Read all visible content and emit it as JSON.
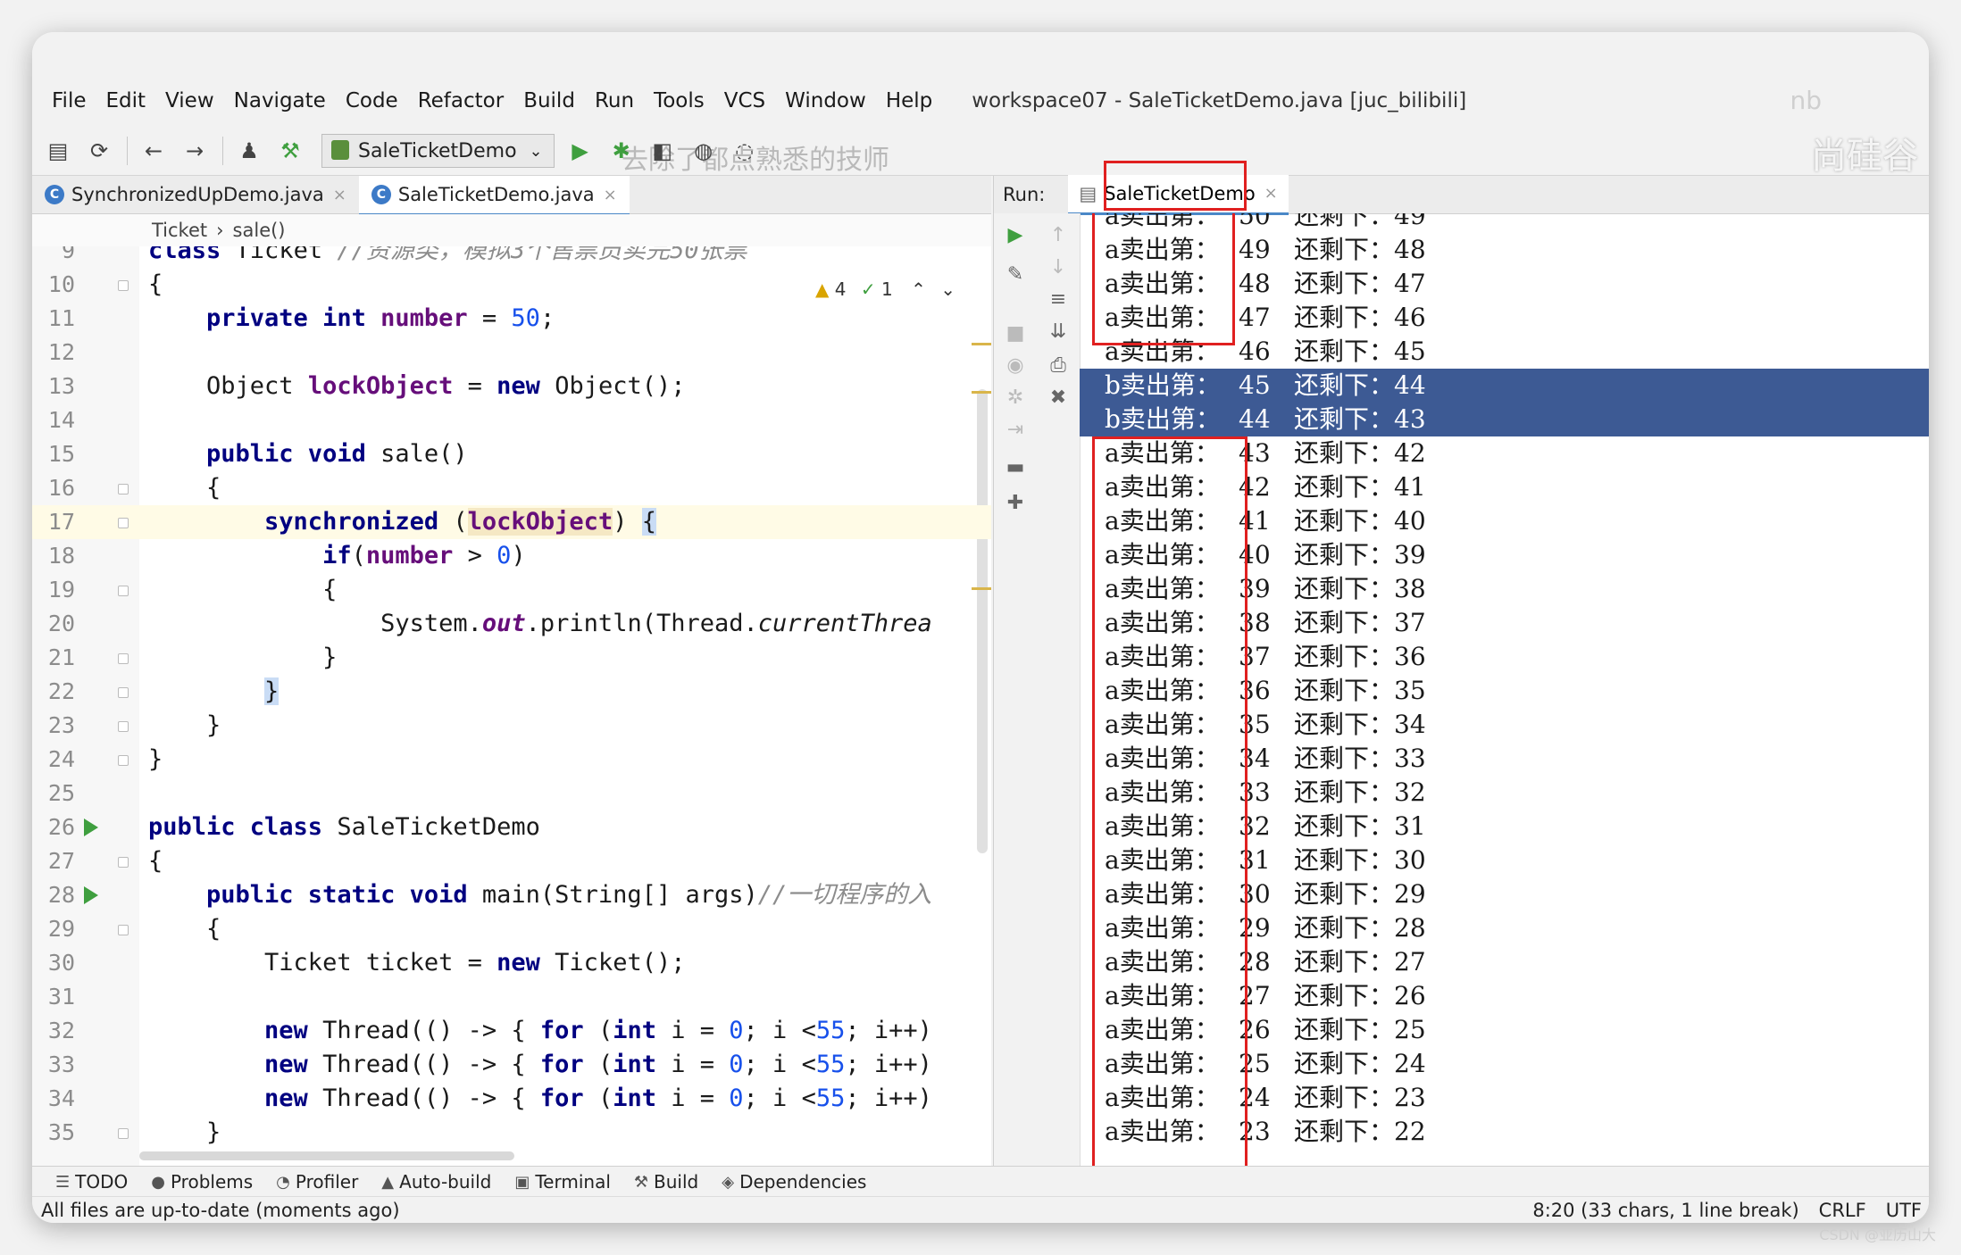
{
  "menu": {
    "items": [
      "File",
      "Edit",
      "View",
      "Navigate",
      "Code",
      "Refactor",
      "Build",
      "Run",
      "Tools",
      "VCS",
      "Window",
      "Help"
    ],
    "window_title": "workspace07 - SaleTicketDemo.java [juc_bilibili]",
    "watermark": "nb"
  },
  "toolbar": {
    "run_config": "SaleTicketDemo",
    "overlay_text": "去除了都点熟悉的技师",
    "brand_watermark": "尚硅谷"
  },
  "editor_tabs": [
    {
      "label": "SynchronizedUpDemo.java",
      "active": false
    },
    {
      "label": "SaleTicketDemo.java",
      "active": true
    }
  ],
  "breadcrumb": {
    "class": "Ticket",
    "method": "sale()"
  },
  "inspections": {
    "warnings": "4",
    "weak": "1"
  },
  "code_lines": [
    {
      "n": "9",
      "segs": [
        {
          "t": "class ",
          "c": "kw"
        },
        {
          "t": "Ticket ",
          "c": ""
        },
        {
          "t": "//资源类，模拟3个售票员卖完50张票",
          "c": "cm"
        }
      ]
    },
    {
      "n": "10",
      "segs": [
        {
          "t": "{",
          "c": ""
        }
      ]
    },
    {
      "n": "11",
      "segs": [
        {
          "t": "    private int ",
          "c": "kw"
        },
        {
          "t": "number",
          "c": "fld"
        },
        {
          "t": " = ",
          "c": ""
        },
        {
          "t": "50",
          "c": "num"
        },
        {
          "t": ";",
          "c": ""
        }
      ]
    },
    {
      "n": "12",
      "segs": []
    },
    {
      "n": "13",
      "segs": [
        {
          "t": "    Object ",
          "c": ""
        },
        {
          "t": "lockObject",
          "c": "fld"
        },
        {
          "t": " = ",
          "c": ""
        },
        {
          "t": "new ",
          "c": "kw"
        },
        {
          "t": "Object();",
          "c": ""
        }
      ]
    },
    {
      "n": "14",
      "segs": []
    },
    {
      "n": "15",
      "segs": [
        {
          "t": "    public void ",
          "c": "kw"
        },
        {
          "t": "sale()",
          "c": ""
        }
      ]
    },
    {
      "n": "16",
      "segs": [
        {
          "t": "    {",
          "c": ""
        }
      ]
    },
    {
      "n": "17",
      "segs": [
        {
          "t": "        synchronized ",
          "c": "kw"
        },
        {
          "t": "(",
          "c": ""
        },
        {
          "t": "lockObject",
          "c": "fld lock-hl"
        },
        {
          "t": ") ",
          "c": ""
        },
        {
          "t": "{",
          "c": "brace-hl"
        }
      ],
      "hl": true
    },
    {
      "n": "18",
      "segs": [
        {
          "t": "            if",
          "c": "kw"
        },
        {
          "t": "(",
          "c": ""
        },
        {
          "t": "number",
          "c": "fld"
        },
        {
          "t": " > ",
          "c": ""
        },
        {
          "t": "0",
          "c": "num"
        },
        {
          "t": ")",
          "c": ""
        }
      ]
    },
    {
      "n": "19",
      "segs": [
        {
          "t": "            {",
          "c": ""
        }
      ]
    },
    {
      "n": "20",
      "segs": [
        {
          "t": "                System.",
          "c": ""
        },
        {
          "t": "out",
          "c": "fld it"
        },
        {
          "t": ".println(Thread.",
          "c": ""
        },
        {
          "t": "currentThrea",
          "c": "it"
        }
      ]
    },
    {
      "n": "21",
      "segs": [
        {
          "t": "            }",
          "c": ""
        }
      ]
    },
    {
      "n": "22",
      "segs": [
        {
          "t": "        ",
          "c": ""
        },
        {
          "t": "}",
          "c": "brace-hl"
        }
      ]
    },
    {
      "n": "23",
      "segs": [
        {
          "t": "    }",
          "c": ""
        }
      ]
    },
    {
      "n": "24",
      "segs": [
        {
          "t": "}",
          "c": ""
        }
      ]
    },
    {
      "n": "25",
      "segs": []
    },
    {
      "n": "26",
      "segs": [
        {
          "t": "public class ",
          "c": "kw"
        },
        {
          "t": "SaleTicketDemo",
          "c": ""
        }
      ]
    },
    {
      "n": "27",
      "segs": [
        {
          "t": "{",
          "c": ""
        }
      ]
    },
    {
      "n": "28",
      "segs": [
        {
          "t": "    public static void ",
          "c": "kw"
        },
        {
          "t": "main(String[] args)",
          "c": ""
        },
        {
          "t": "//一切程序的入",
          "c": "cm"
        }
      ]
    },
    {
      "n": "29",
      "segs": [
        {
          "t": "    {",
          "c": ""
        }
      ]
    },
    {
      "n": "30",
      "segs": [
        {
          "t": "        Ticket ticket = ",
          "c": ""
        },
        {
          "t": "new ",
          "c": "kw"
        },
        {
          "t": "Ticket();",
          "c": ""
        }
      ]
    },
    {
      "n": "31",
      "segs": []
    },
    {
      "n": "32",
      "segs": [
        {
          "t": "        new ",
          "c": "kw"
        },
        {
          "t": "Thread(() -> { ",
          "c": ""
        },
        {
          "t": "for ",
          "c": "kw"
        },
        {
          "t": "(",
          "c": ""
        },
        {
          "t": "int ",
          "c": "kw"
        },
        {
          "t": "i = ",
          "c": ""
        },
        {
          "t": "0",
          "c": "num"
        },
        {
          "t": "; i <",
          "c": ""
        },
        {
          "t": "55",
          "c": "num"
        },
        {
          "t": "; i++)",
          "c": ""
        }
      ]
    },
    {
      "n": "33",
      "segs": [
        {
          "t": "        new ",
          "c": "kw"
        },
        {
          "t": "Thread(() -> { ",
          "c": ""
        },
        {
          "t": "for ",
          "c": "kw"
        },
        {
          "t": "(",
          "c": ""
        },
        {
          "t": "int ",
          "c": "kw"
        },
        {
          "t": "i = ",
          "c": ""
        },
        {
          "t": "0",
          "c": "num"
        },
        {
          "t": "; i <",
          "c": ""
        },
        {
          "t": "55",
          "c": "num"
        },
        {
          "t": "; i++)",
          "c": ""
        }
      ]
    },
    {
      "n": "34",
      "segs": [
        {
          "t": "        new ",
          "c": "kw"
        },
        {
          "t": "Thread(() -> { ",
          "c": ""
        },
        {
          "t": "for ",
          "c": "kw"
        },
        {
          "t": "(",
          "c": ""
        },
        {
          "t": "int ",
          "c": "kw"
        },
        {
          "t": "i = ",
          "c": ""
        },
        {
          "t": "0",
          "c": "num"
        },
        {
          "t": "; i <",
          "c": ""
        },
        {
          "t": "55",
          "c": "num"
        },
        {
          "t": "; i++)",
          "c": ""
        }
      ]
    },
    {
      "n": "35",
      "segs": [
        {
          "t": "    }",
          "c": ""
        }
      ]
    }
  ],
  "run": {
    "label": "Run:",
    "tab": "SaleTicketDemo",
    "output": [
      {
        "thread": "a卖出第：",
        "sold": "50",
        "remain": "还剩下：49"
      },
      {
        "thread": "a卖出第：",
        "sold": "49",
        "remain": "还剩下：48"
      },
      {
        "thread": "a卖出第：",
        "sold": "48",
        "remain": "还剩下：47"
      },
      {
        "thread": "a卖出第：",
        "sold": "47",
        "remain": "还剩下：46"
      },
      {
        "thread": "a卖出第：",
        "sold": "46",
        "remain": "还剩下：45"
      },
      {
        "thread": "b卖出第：",
        "sold": "45",
        "remain": "还剩下：44",
        "selected": true
      },
      {
        "thread": "b卖出第：",
        "sold": "44",
        "remain": "还剩下：43",
        "selected": true
      },
      {
        "thread": "a卖出第：",
        "sold": "43",
        "remain": "还剩下：42"
      },
      {
        "thread": "a卖出第：",
        "sold": "42",
        "remain": "还剩下：41"
      },
      {
        "thread": "a卖出第：",
        "sold": "41",
        "remain": "还剩下：40"
      },
      {
        "thread": "a卖出第：",
        "sold": "40",
        "remain": "还剩下：39"
      },
      {
        "thread": "a卖出第：",
        "sold": "39",
        "remain": "还剩下：38"
      },
      {
        "thread": "a卖出第：",
        "sold": "38",
        "remain": "还剩下：37"
      },
      {
        "thread": "a卖出第：",
        "sold": "37",
        "remain": "还剩下：36"
      },
      {
        "thread": "a卖出第：",
        "sold": "36",
        "remain": "还剩下：35"
      },
      {
        "thread": "a卖出第：",
        "sold": "35",
        "remain": "还剩下：34"
      },
      {
        "thread": "a卖出第：",
        "sold": "34",
        "remain": "还剩下：33"
      },
      {
        "thread": "a卖出第：",
        "sold": "33",
        "remain": "还剩下：32"
      },
      {
        "thread": "a卖出第：",
        "sold": "32",
        "remain": "还剩下：31"
      },
      {
        "thread": "a卖出第：",
        "sold": "31",
        "remain": "还剩下：30"
      },
      {
        "thread": "a卖出第：",
        "sold": "30",
        "remain": "还剩下：29"
      },
      {
        "thread": "a卖出第：",
        "sold": "29",
        "remain": "还剩下：28"
      },
      {
        "thread": "a卖出第：",
        "sold": "28",
        "remain": "还剩下：27"
      },
      {
        "thread": "a卖出第：",
        "sold": "27",
        "remain": "还剩下：26"
      },
      {
        "thread": "a卖出第：",
        "sold": "26",
        "remain": "还剩下：25"
      },
      {
        "thread": "a卖出第：",
        "sold": "25",
        "remain": "还剩下：24"
      },
      {
        "thread": "a卖出第：",
        "sold": "24",
        "remain": "还剩下：23"
      },
      {
        "thread": "a卖出第：",
        "sold": "23",
        "remain": "还剩下：22"
      }
    ]
  },
  "bottom_tools": [
    {
      "icon": "todo-icon",
      "glyph": "☰",
      "label": "TODO"
    },
    {
      "icon": "problems-icon",
      "glyph": "●",
      "label": "Problems"
    },
    {
      "icon": "profiler-icon",
      "glyph": "◔",
      "label": "Profiler"
    },
    {
      "icon": "auto-build-icon",
      "glyph": "▲",
      "label": "Auto-build"
    },
    {
      "icon": "terminal-icon",
      "glyph": "▣",
      "label": "Terminal"
    },
    {
      "icon": "build-icon",
      "glyph": "⚒",
      "label": "Build"
    },
    {
      "icon": "dependencies-icon",
      "glyph": "◈",
      "label": "Dependencies"
    }
  ],
  "status": {
    "message": "All files are up-to-date (moments ago)",
    "position": "8:20 (33 chars, 1 line break)",
    "line_sep": "CRLF",
    "encoding": "UTF",
    "source_watermark": "CSDN @亚历山大"
  }
}
